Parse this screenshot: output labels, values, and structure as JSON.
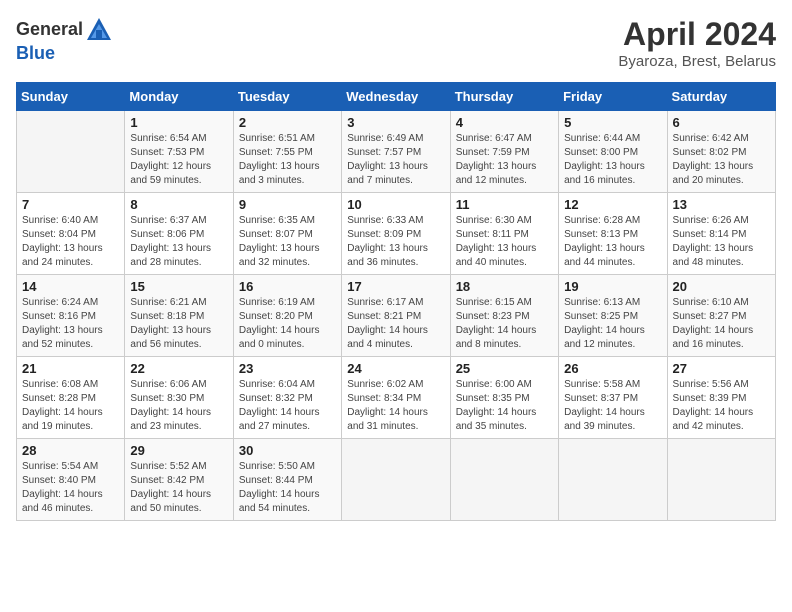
{
  "logo": {
    "general": "General",
    "blue": "Blue"
  },
  "title": "April 2024",
  "location": "Byaroza, Brest, Belarus",
  "weekdays": [
    "Sunday",
    "Monday",
    "Tuesday",
    "Wednesday",
    "Thursday",
    "Friday",
    "Saturday"
  ],
  "weeks": [
    [
      {
        "day": "",
        "info": ""
      },
      {
        "day": "1",
        "info": "Sunrise: 6:54 AM\nSunset: 7:53 PM\nDaylight: 12 hours\nand 59 minutes."
      },
      {
        "day": "2",
        "info": "Sunrise: 6:51 AM\nSunset: 7:55 PM\nDaylight: 13 hours\nand 3 minutes."
      },
      {
        "day": "3",
        "info": "Sunrise: 6:49 AM\nSunset: 7:57 PM\nDaylight: 13 hours\nand 7 minutes."
      },
      {
        "day": "4",
        "info": "Sunrise: 6:47 AM\nSunset: 7:59 PM\nDaylight: 13 hours\nand 12 minutes."
      },
      {
        "day": "5",
        "info": "Sunrise: 6:44 AM\nSunset: 8:00 PM\nDaylight: 13 hours\nand 16 minutes."
      },
      {
        "day": "6",
        "info": "Sunrise: 6:42 AM\nSunset: 8:02 PM\nDaylight: 13 hours\nand 20 minutes."
      }
    ],
    [
      {
        "day": "7",
        "info": "Sunrise: 6:40 AM\nSunset: 8:04 PM\nDaylight: 13 hours\nand 24 minutes."
      },
      {
        "day": "8",
        "info": "Sunrise: 6:37 AM\nSunset: 8:06 PM\nDaylight: 13 hours\nand 28 minutes."
      },
      {
        "day": "9",
        "info": "Sunrise: 6:35 AM\nSunset: 8:07 PM\nDaylight: 13 hours\nand 32 minutes."
      },
      {
        "day": "10",
        "info": "Sunrise: 6:33 AM\nSunset: 8:09 PM\nDaylight: 13 hours\nand 36 minutes."
      },
      {
        "day": "11",
        "info": "Sunrise: 6:30 AM\nSunset: 8:11 PM\nDaylight: 13 hours\nand 40 minutes."
      },
      {
        "day": "12",
        "info": "Sunrise: 6:28 AM\nSunset: 8:13 PM\nDaylight: 13 hours\nand 44 minutes."
      },
      {
        "day": "13",
        "info": "Sunrise: 6:26 AM\nSunset: 8:14 PM\nDaylight: 13 hours\nand 48 minutes."
      }
    ],
    [
      {
        "day": "14",
        "info": "Sunrise: 6:24 AM\nSunset: 8:16 PM\nDaylight: 13 hours\nand 52 minutes."
      },
      {
        "day": "15",
        "info": "Sunrise: 6:21 AM\nSunset: 8:18 PM\nDaylight: 13 hours\nand 56 minutes."
      },
      {
        "day": "16",
        "info": "Sunrise: 6:19 AM\nSunset: 8:20 PM\nDaylight: 14 hours\nand 0 minutes."
      },
      {
        "day": "17",
        "info": "Sunrise: 6:17 AM\nSunset: 8:21 PM\nDaylight: 14 hours\nand 4 minutes."
      },
      {
        "day": "18",
        "info": "Sunrise: 6:15 AM\nSunset: 8:23 PM\nDaylight: 14 hours\nand 8 minutes."
      },
      {
        "day": "19",
        "info": "Sunrise: 6:13 AM\nSunset: 8:25 PM\nDaylight: 14 hours\nand 12 minutes."
      },
      {
        "day": "20",
        "info": "Sunrise: 6:10 AM\nSunset: 8:27 PM\nDaylight: 14 hours\nand 16 minutes."
      }
    ],
    [
      {
        "day": "21",
        "info": "Sunrise: 6:08 AM\nSunset: 8:28 PM\nDaylight: 14 hours\nand 19 minutes."
      },
      {
        "day": "22",
        "info": "Sunrise: 6:06 AM\nSunset: 8:30 PM\nDaylight: 14 hours\nand 23 minutes."
      },
      {
        "day": "23",
        "info": "Sunrise: 6:04 AM\nSunset: 8:32 PM\nDaylight: 14 hours\nand 27 minutes."
      },
      {
        "day": "24",
        "info": "Sunrise: 6:02 AM\nSunset: 8:34 PM\nDaylight: 14 hours\nand 31 minutes."
      },
      {
        "day": "25",
        "info": "Sunrise: 6:00 AM\nSunset: 8:35 PM\nDaylight: 14 hours\nand 35 minutes."
      },
      {
        "day": "26",
        "info": "Sunrise: 5:58 AM\nSunset: 8:37 PM\nDaylight: 14 hours\nand 39 minutes."
      },
      {
        "day": "27",
        "info": "Sunrise: 5:56 AM\nSunset: 8:39 PM\nDaylight: 14 hours\nand 42 minutes."
      }
    ],
    [
      {
        "day": "28",
        "info": "Sunrise: 5:54 AM\nSunset: 8:40 PM\nDaylight: 14 hours\nand 46 minutes."
      },
      {
        "day": "29",
        "info": "Sunrise: 5:52 AM\nSunset: 8:42 PM\nDaylight: 14 hours\nand 50 minutes."
      },
      {
        "day": "30",
        "info": "Sunrise: 5:50 AM\nSunset: 8:44 PM\nDaylight: 14 hours\nand 54 minutes."
      },
      {
        "day": "",
        "info": ""
      },
      {
        "day": "",
        "info": ""
      },
      {
        "day": "",
        "info": ""
      },
      {
        "day": "",
        "info": ""
      }
    ]
  ]
}
